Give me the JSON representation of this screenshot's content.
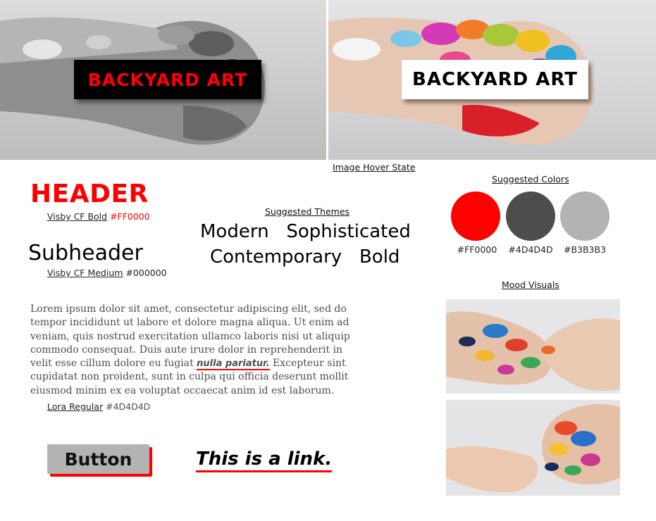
{
  "hero": {
    "default_title": "BACKYARD ART",
    "hover_title": "BACKYARD ART",
    "hover_caption": "Image Hover State"
  },
  "typography": {
    "header_sample": "HEADER",
    "header_font": "Visby CF Bold",
    "header_color": "#FF0000",
    "subheader_sample": "Subheader",
    "subheader_font": "Visby CF Medium",
    "subheader_color": "#000000",
    "body_font": "Lora Regular",
    "body_color": "#4D4D4D"
  },
  "themes": {
    "title": "Suggested Themes",
    "line1_a": "Modern",
    "line1_b": "Sophisticated",
    "line2_a": "Contemporary",
    "line2_b": "Bold"
  },
  "colors": {
    "title": "Suggested Colors",
    "swatches": [
      {
        "hex": "#FF0000",
        "label": "#FF0000"
      },
      {
        "hex": "#4D4D4D",
        "label": "#4D4D4D"
      },
      {
        "hex": "#B3B3B3",
        "label": "#B3B3B3"
      }
    ]
  },
  "body": {
    "text_before": "Lorem ipsum dolor sit amet, consectetur adipiscing elit, sed do tempor incididunt ut labore et dolore magna aliqua. Ut enim ad veniam, quis nostrud exercitation ullamco laboris nisi ut aliquip commodo consequat. Duis aute irure dolor in reprehenderit in velit esse cillum dolore eu fugiat ",
    "inline_link": "nulla pariatur.",
    "text_after": " Excepteur sint cupidatat non proident, sunt in culpa qui officia deserunt mollit eiusmod minim ex ea voluptat occaecat anim id est laborum."
  },
  "button": {
    "label": "Button"
  },
  "link": {
    "label": "This is a link."
  },
  "mood": {
    "title": "Mood Visuals"
  }
}
